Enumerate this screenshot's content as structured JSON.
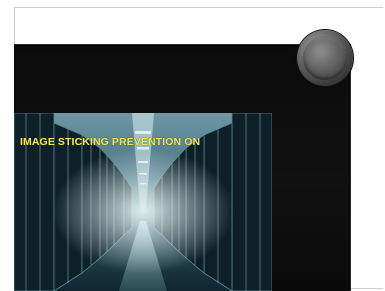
{
  "screen": {
    "osd_message": "IMAGE STICKING PREVENTION ON"
  },
  "colors": {
    "osd_text": "#f1e35c",
    "bezel": "#0b0b0b",
    "screen_tint": "#5a8fa0"
  },
  "icons": {
    "hardware_button": "round-button-icon"
  }
}
